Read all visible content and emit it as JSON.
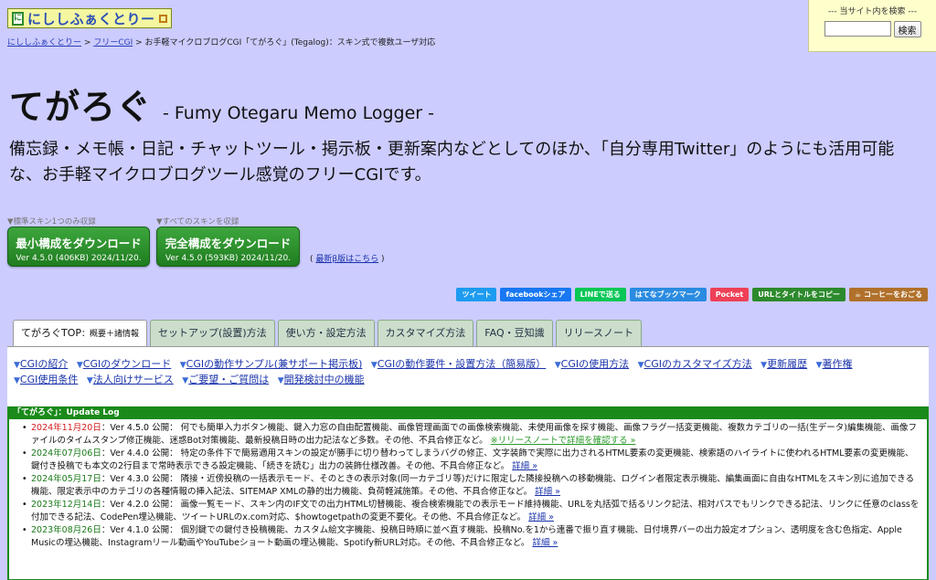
{
  "logo": {
    "mark": "に",
    "text": "にししふぁくとりー"
  },
  "site_search": {
    "label": "--- 当サイト内を検索 ---",
    "button": "検索"
  },
  "breadcrumb": {
    "home": "にししふぁくとりー",
    "sep": ">",
    "free_cgi": "フリーCGI",
    "current": "お手軽マイクロブログCGI「てがろぐ」(Tegalog)：スキン式で複数ユーザ対応"
  },
  "header": {
    "title": "てがろぐ",
    "subtitle": "- Fumy Otegaru Memo Logger -",
    "description": "備忘録・メモ帳・日記・チャットツール・掲示板・更新案内などとしてのほか、「自分専用Twitter」のようにも活用可能な、お手軽マイクロブログツール感覚のフリーCGIです。"
  },
  "downloads": {
    "min": {
      "caption": "▼標準スキン1つのみ収録",
      "label": "最小構成をダウンロード",
      "sub": "Ver 4.5.0 (406KB) 2024/11/20."
    },
    "full": {
      "caption": "▼すべてのスキンを収録",
      "label": "完全構成をダウンロード",
      "sub": "Ver 4.5.0 (593KB) 2024/11/20."
    },
    "beta": {
      "open": "(",
      "link": "最新β版はこちら",
      "close": ")"
    }
  },
  "share_buttons": [
    {
      "label": "ツイート",
      "color": "#1d9bf0"
    },
    {
      "label": "facebookシェア",
      "color": "#1877f2"
    },
    {
      "label": "LINEで送る",
      "color": "#06c755"
    },
    {
      "label": "はてなブックマーク",
      "color": "#2a8be0"
    },
    {
      "label": "Pocket",
      "color": "#ef4056"
    },
    {
      "label": "URLとタイトルをコピー",
      "color": "#2c8a2c"
    },
    {
      "label": "☕ コーヒーをおごる",
      "color": "#b0702a"
    }
  ],
  "tabs": [
    {
      "label": "てがろぐTOP",
      "note": "：概要＋諸情報"
    },
    {
      "label": "セットアップ(設置)方法"
    },
    {
      "label": "使い方・設定方法"
    },
    {
      "label": "カスタマイズ方法"
    },
    {
      "label": "FAQ・豆知識"
    },
    {
      "label": "リリースノート"
    }
  ],
  "anchor_nav": [
    "CGIの紹介",
    "CGIのダウンロード",
    "CGIの動作サンプル(兼サポート掲示板)",
    "CGIの動作要件・設置方法（簡易版）",
    "CGIの使用方法",
    "CGIのカスタマイズ方法",
    "更新履歴",
    "著作権",
    "CGI使用条件",
    "法人向けサービス",
    "ご要望・ご質問は",
    "開発検討中の機能"
  ],
  "update_log": {
    "title": "「てがろぐ」：Update Log",
    "entries": [
      {
        "date": "2024年11月20日",
        "text": "：Ver 4.5.0 公開： 何でも簡単入力ボタン機能、鍵入力窓の自由配置機能、画像管理画面での画像検索機能、未使用画像を探す機能、画像フラグ一括変更機能、複数カテゴリの一括(生データ)編集機能、画像ファイルのタイムスタンプ修正機能、迷惑Bot対策機能、最新投稿日時の出力記法など多数。その他、不具合修正など。",
        "link": "※リリースノートで詳細を確認する »"
      },
      {
        "date": "2024年07月06日",
        "text": "：Ver 4.4.0 公開： 特定の条件下で簡易適用スキンの設定が勝手に切り替わってしまうバグの修正、文字装飾で実際に出力されるHTML要素の変更機能、検索語のハイライトに使われるHTML要素の変更機能、鍵付き投稿でも本文の2行目まで常時表示できる設定機能、「続きを読む」出力の装飾仕様改善。その他、不具合修正など。",
        "link": "詳細 »"
      },
      {
        "date": "2024年05月17日",
        "text": "：Ver 4.3.0 公開： 隣接・近傍投稿の一括表示モード、そのときの表示対象(同一カテゴリ等)だけに限定した隣接投稿への移動機能、ログイン者限定表示機能、編集画面に自由なHTMLをスキン別に追加できる機能、限定表示中のカテゴリの各種情報の挿入記法、SITEMAP XMLの静的出力機能、負荷軽減施策。その他、不具合修正など。",
        "link": "詳細 »"
      },
      {
        "date": "2023年12月14日",
        "text": "：Ver 4.2.0 公開： 画像一覧モード、スキン内のIF文での出力HTML切替機能、複合検索機能での表示モード維持機能、URLを丸括弧で括るリンク記法、相対パスでもリンクできる記法、リンクに任意のclassを付加できる記法、CodePen埋込機能、ツイートURLのx.com対応、$howtogetpathの変更不要化。その他、不具合修正など。",
        "link": "詳細 »"
      },
      {
        "date": "2023年08月26日",
        "text": "：Ver 4.1.0 公開： 個別鍵での鍵付き投稿機能、カスタム絵文字機能、投稿日時順に並べ直す機能、投稿No.を1から連番で振り直す機能、日付境界バーの出力設定オプション、透明度を含む色指定、Apple Musicの埋込機能、Instagramリール動画やYouTubeショート動画の埋込機能、Spotify新URL対応。その他、不具合修正など。",
        "link": "詳細 »"
      }
    ]
  }
}
